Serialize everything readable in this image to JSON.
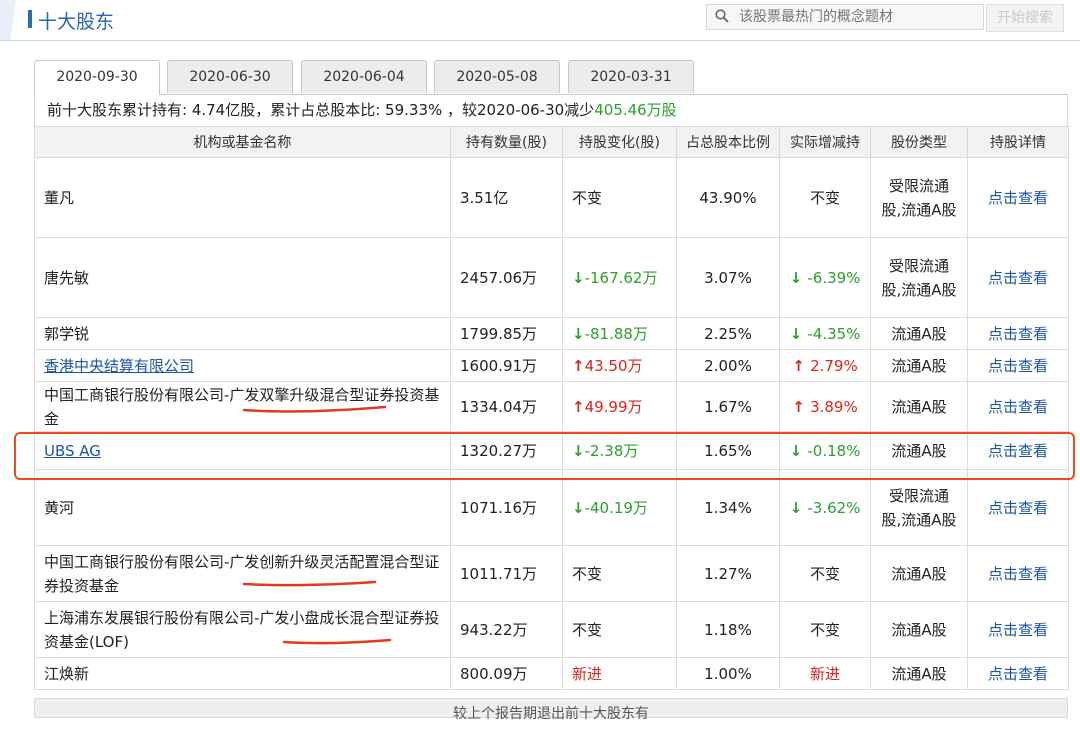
{
  "header": {
    "title": "十大股东",
    "search_placeholder": "该股票最热门的概念题材",
    "search_button": "开始搜索"
  },
  "tabs": [
    "2020-09-30",
    "2020-06-30",
    "2020-06-04",
    "2020-05-08",
    "2020-03-31"
  ],
  "summary": {
    "prefix": "前十大股东累计持有:  4.74亿股，累计占总股本比: 59.33% ，较2020-06-30减少",
    "change": "405.46万股"
  },
  "columns": [
    "机构或基金名称",
    "持有数量(股)",
    "持股变化(股)",
    "占总股本比例",
    "实际增减持",
    "股份类型",
    "持股详情"
  ],
  "rows": [
    {
      "name": "董凡",
      "link": false,
      "qty": "3.51亿",
      "chg": "不变",
      "chg_dir": "none",
      "pct": "43.90%",
      "actual": "不变",
      "actual_dir": "none",
      "type": "受限流通股,流通A股",
      "detail": "点击查看"
    },
    {
      "name": "唐先敏",
      "link": false,
      "qty": "2457.06万",
      "chg": "-167.62万",
      "chg_dir": "down",
      "pct": "3.07%",
      "actual": "-6.39%",
      "actual_dir": "down",
      "type": "受限流通股,流通A股",
      "detail": "点击查看"
    },
    {
      "name": "郭学锐",
      "link": false,
      "qty": "1799.85万",
      "chg": "-81.88万",
      "chg_dir": "down",
      "pct": "2.25%",
      "actual": "-4.35%",
      "actual_dir": "down",
      "type": "流通A股",
      "detail": "点击查看"
    },
    {
      "name": "香港中央结算有限公司",
      "link": true,
      "qty": "1600.91万",
      "chg": "43.50万",
      "chg_dir": "up",
      "pct": "2.00%",
      "actual": "2.79%",
      "actual_dir": "up",
      "type": "流通A股",
      "detail": "点击查看"
    },
    {
      "name": "中国工商银行股份有限公司-广发双擎升级混合型证券投资基金",
      "link": false,
      "qty": "1334.04万",
      "chg": "49.99万",
      "chg_dir": "up",
      "pct": "1.67%",
      "actual": "3.89%",
      "actual_dir": "up",
      "type": "流通A股",
      "detail": "点击查看"
    },
    {
      "name": "UBS AG",
      "link": true,
      "qty": "1320.27万",
      "chg": "-2.38万",
      "chg_dir": "down",
      "pct": "1.65%",
      "actual": "-0.18%",
      "actual_dir": "down",
      "type": "流通A股",
      "detail": "点击查看"
    },
    {
      "name": "黄河",
      "link": false,
      "qty": "1071.16万",
      "chg": "-40.19万",
      "chg_dir": "down",
      "pct": "1.34%",
      "actual": "-3.62%",
      "actual_dir": "down",
      "type": "受限流通股,流通A股",
      "detail": "点击查看"
    },
    {
      "name": "中国工商银行股份有限公司-广发创新升级灵活配置混合型证券投资基金",
      "link": false,
      "qty": "1011.71万",
      "chg": "不变",
      "chg_dir": "none",
      "pct": "1.27%",
      "actual": "不变",
      "actual_dir": "none",
      "type": "流通A股",
      "detail": "点击查看"
    },
    {
      "name": "上海浦东发展银行股份有限公司-广发小盘成长混合型证券投资基金(LOF)",
      "link": false,
      "qty": "943.22万",
      "chg": "不变",
      "chg_dir": "none",
      "pct": "1.18%",
      "actual": "不变",
      "actual_dir": "none",
      "type": "流通A股",
      "detail": "点击查看"
    },
    {
      "name": "江焕新",
      "link": false,
      "qty": "800.09万",
      "chg": "新进",
      "chg_dir": "new",
      "pct": "1.00%",
      "actual": "新进",
      "actual_dir": "new",
      "type": "流通A股",
      "detail": "点击查看"
    }
  ],
  "footer_text": "较上个报告期退出前十大股东有",
  "colors": {
    "accent": "#2b66b1",
    "down": "#2c9e2c",
    "up": "#d8271c",
    "highlight": "#ef4a1d"
  }
}
